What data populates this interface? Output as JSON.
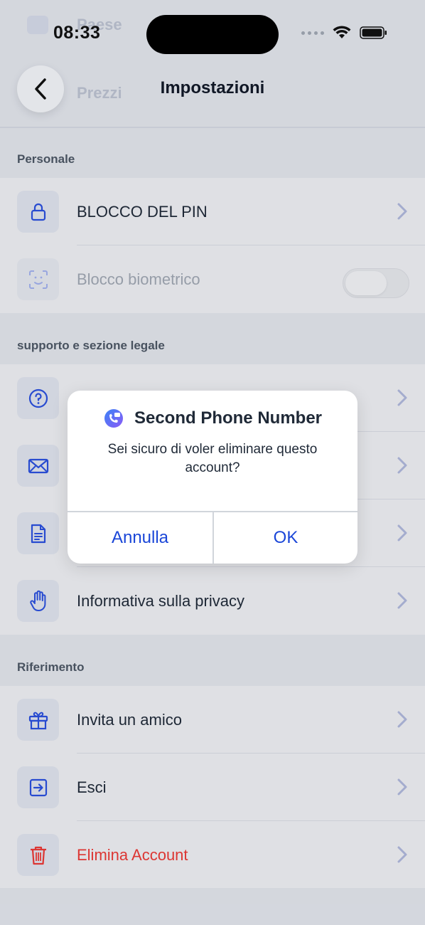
{
  "status": {
    "time": "08:33"
  },
  "background_ghost": {
    "item1": "Paese",
    "item2": "Prezzi"
  },
  "header": {
    "title": "Impostazioni"
  },
  "sections": {
    "personal": {
      "label": "Personale",
      "items": [
        {
          "label": "BLOCCO DEL PIN",
          "icon": "lock-icon"
        },
        {
          "label": "Blocco biometrico",
          "icon": "face-id-icon",
          "toggle": false
        }
      ]
    },
    "support": {
      "label": "supporto e sezione legale",
      "items": [
        {
          "label": "",
          "icon": "help-icon"
        },
        {
          "label": "",
          "icon": "mail-icon"
        },
        {
          "label": "",
          "icon": "document-icon"
        },
        {
          "label": "Informativa sulla privacy",
          "icon": "hand-icon"
        }
      ]
    },
    "referral": {
      "label": "Riferimento",
      "items": [
        {
          "label": "Invita un amico",
          "icon": "gift-icon"
        },
        {
          "label": "Esci",
          "icon": "logout-icon"
        },
        {
          "label": "Elimina Account",
          "icon": "trash-icon"
        }
      ]
    }
  },
  "dialog": {
    "app_name": "Second Phone Number",
    "message": "Sei sicuro di voler eliminare questo account?",
    "cancel_label": "Annulla",
    "ok_label": "OK"
  },
  "colors": {
    "accent": "#1a46d8",
    "danger": "#e53935",
    "icon": "#2a4ed8"
  }
}
